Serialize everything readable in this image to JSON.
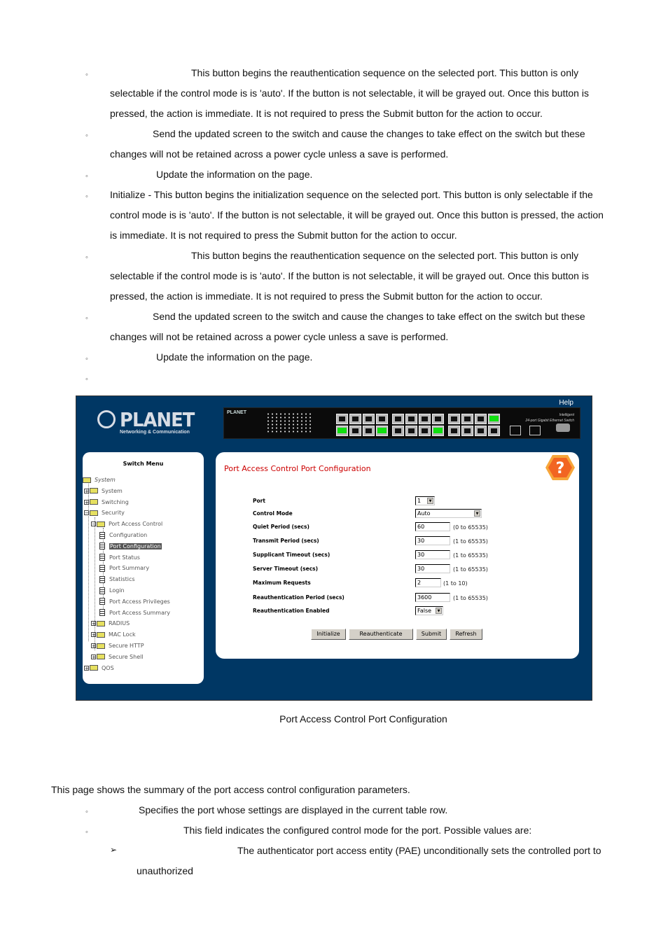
{
  "doc": {
    "top_items": [
      {
        "lines": [
          "This button begins the reauthentication sequence on the selected port. This button is only",
          "selectable if the control mode is is 'auto'. If the button is not selectable, it will be grayed out. Once this button is",
          "pressed, the action is immediate. It is not required to press the Submit button for the action to occur."
        ]
      },
      {
        "lines": [
          "Send the updated screen to the switch and cause the changes to take effect on the switch but these",
          "changes will not be retained across a power cycle unless a save is performed."
        ]
      },
      {
        "lines": [
          "Update the information on the page."
        ]
      },
      {
        "lines": [
          "Initialize - This button begins the initialization sequence on the selected port. This button is only selectable if the",
          "control mode is is 'auto'. If the button is not selectable, it will be grayed out. Once this button is pressed, the action",
          "is immediate. It is not required to press the Submit button for the action to occur."
        ]
      },
      {
        "lines": [
          "This button begins the reauthentication sequence on the selected port. This button is only",
          "selectable if the control mode is is 'auto'. If the button is not selectable, it will be grayed out. Once this button is",
          "pressed, the action is immediate. It is not required to press the Submit button for the action to occur."
        ]
      },
      {
        "lines": [
          "Send the updated screen to the switch and cause the changes to take effect on the switch but these",
          "changes will not be retained across a power cycle unless a save is performed."
        ]
      },
      {
        "lines": [
          "Update the information on the page."
        ]
      },
      {
        "lines": [
          ""
        ]
      }
    ],
    "bullet_glyph": "◦",
    "caption": "Port Access Control Port Configuration",
    "summary_intro": "This page shows the summary of the port access control configuration parameters.",
    "summary_items": [
      "Specifies the port whose settings are displayed in the current table row.",
      "This field indicates the configured control mode for the port. Possible values are:"
    ],
    "sub_bullet_glyph": "➢",
    "sub_item_lines": [
      "The authenticator port access entity (PAE) unconditionally sets the controlled port to",
      "unauthorized"
    ]
  },
  "screenshot": {
    "help_label": "Help",
    "logo": {
      "brand": "PLANET",
      "tagline": "Networking & Communication"
    },
    "switch_panel": {
      "brand": "PLANET",
      "title_line1": "Intelligent",
      "title_line2": "24-port Gigabit Ethernet Switch",
      "active_ports_top": [
        12
      ],
      "active_ports_bottom": [
        1,
        4,
        8
      ]
    },
    "menu": {
      "title": "Switch Menu",
      "items": [
        {
          "label": "System",
          "level": 0,
          "type": "root"
        },
        {
          "label": "System",
          "level": 0,
          "type": "folder"
        },
        {
          "label": "Switching",
          "level": 0,
          "type": "folder"
        },
        {
          "label": "Security",
          "level": 0,
          "type": "folder-open"
        },
        {
          "label": "Port Access Control",
          "level": 1,
          "type": "folder-open"
        },
        {
          "label": "Configuration",
          "level": 2,
          "type": "doc"
        },
        {
          "label": "Port Configuration",
          "level": 2,
          "type": "doc",
          "selected": true
        },
        {
          "label": "Port Status",
          "level": 2,
          "type": "doc"
        },
        {
          "label": "Port Summary",
          "level": 2,
          "type": "doc"
        },
        {
          "label": "Statistics",
          "level": 2,
          "type": "doc"
        },
        {
          "label": "Login",
          "level": 2,
          "type": "doc"
        },
        {
          "label": "Port Access Privileges",
          "level": 2,
          "type": "doc"
        },
        {
          "label": "Port Access Summary",
          "level": 2,
          "type": "doc"
        },
        {
          "label": "RADIUS",
          "level": 1,
          "type": "folder"
        },
        {
          "label": "MAC Lock",
          "level": 1,
          "type": "folder"
        },
        {
          "label": "Secure HTTP",
          "level": 1,
          "type": "folder"
        },
        {
          "label": "Secure Shell",
          "level": 1,
          "type": "folder"
        },
        {
          "label": "QOS",
          "level": 0,
          "type": "folder"
        }
      ]
    },
    "form": {
      "title": "Port Access Control Port Configuration",
      "fields": [
        {
          "label": "Port",
          "kind": "select",
          "value": "1",
          "range": ""
        },
        {
          "label": "Control Mode",
          "kind": "select",
          "value": "Auto",
          "range": ""
        },
        {
          "label": "Quiet Period (secs)",
          "kind": "input",
          "value": "60",
          "range": "(0 to 65535)"
        },
        {
          "label": "Transmit Period (secs)",
          "kind": "input",
          "value": "30",
          "range": "(1 to 65535)"
        },
        {
          "label": "Supplicant Timeout (secs)",
          "kind": "input",
          "value": "30",
          "range": "(1 to 65535)"
        },
        {
          "label": "Server Timeout (secs)",
          "kind": "input",
          "value": "30",
          "range": "(1 to 65535)"
        },
        {
          "label": "Maximum Requests",
          "kind": "input",
          "value": "2",
          "range": "(1 to 10)"
        },
        {
          "label": "Reauthentication Period (secs)",
          "kind": "input",
          "value": "3600",
          "range": "(1 to 65535)"
        },
        {
          "label": "Reauthentication Enabled",
          "kind": "select",
          "value": "False",
          "range": ""
        }
      ],
      "buttons": {
        "initialize": "Initialize",
        "reauthenticate": "Reauthenticate",
        "submit": "Submit",
        "refresh": "Refresh"
      }
    },
    "colors": {
      "background": "#003764",
      "title_red": "#cc0000",
      "help_orange": "#f26522",
      "port_active": "#10e010"
    }
  }
}
